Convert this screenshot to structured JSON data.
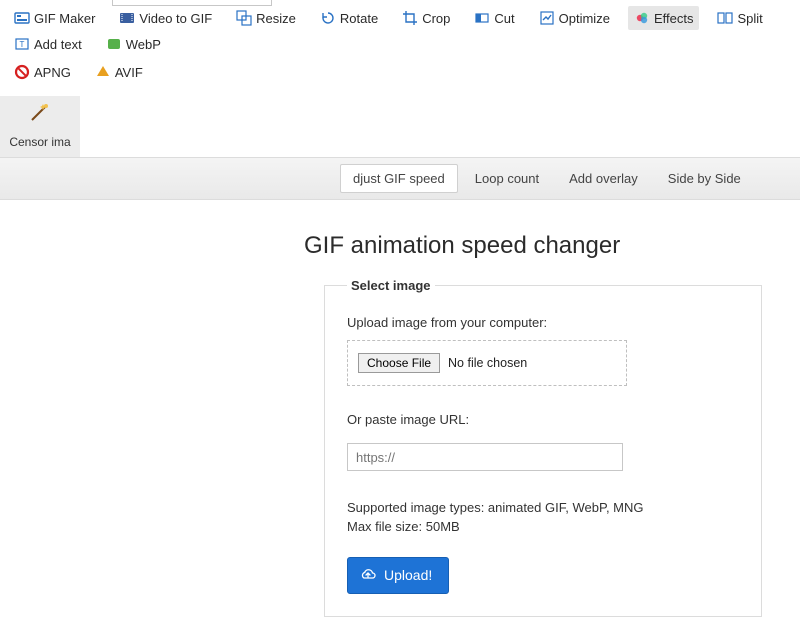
{
  "toolbar": {
    "items": [
      {
        "id": "gif-maker",
        "label": "GIF Maker"
      },
      {
        "id": "video-to-gif",
        "label": "Video to GIF"
      },
      {
        "id": "resize",
        "label": "Resize"
      },
      {
        "id": "rotate",
        "label": "Rotate"
      },
      {
        "id": "crop",
        "label": "Crop"
      },
      {
        "id": "cut",
        "label": "Cut"
      },
      {
        "id": "optimize",
        "label": "Optimize"
      },
      {
        "id": "effects",
        "label": "Effects",
        "active": true
      },
      {
        "id": "split",
        "label": "Split"
      },
      {
        "id": "add-text",
        "label": "Add text"
      },
      {
        "id": "webp",
        "label": "WebP"
      }
    ],
    "items_row2": [
      {
        "id": "apng",
        "label": "APNG"
      },
      {
        "id": "avif",
        "label": "AVIF"
      }
    ],
    "censor": {
      "label": "Censor ima"
    }
  },
  "tabs": {
    "items": [
      {
        "id": "adjust-speed",
        "label": "djust GIF speed",
        "selected": true
      },
      {
        "id": "loop-count",
        "label": "Loop count"
      },
      {
        "id": "add-overlay",
        "label": "Add overlay"
      },
      {
        "id": "side-by-side",
        "label": "Side by Side"
      }
    ]
  },
  "page": {
    "title": "GIF animation speed changer"
  },
  "form": {
    "legend": "Select image",
    "upload_label": "Upload image from your computer:",
    "choose_file": "Choose File",
    "no_file": "No file chosen",
    "or_label": "Or paste image URL:",
    "url_placeholder": "https://",
    "hint_line1": "Supported image types: animated GIF, WebP, MNG",
    "hint_line2": "Max file size: 50MB",
    "upload_button": "Upload!"
  }
}
